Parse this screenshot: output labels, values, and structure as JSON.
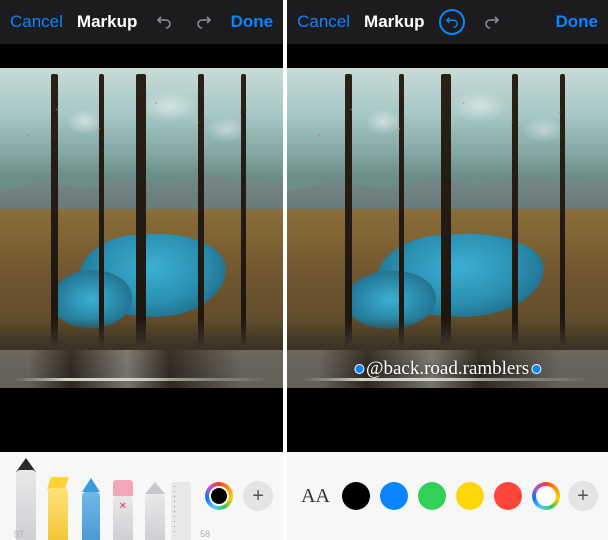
{
  "panes": [
    {
      "header": {
        "cancel": "Cancel",
        "title": "Markup",
        "done": "Done",
        "undo_active": false
      },
      "watermark": null,
      "toolbar": {
        "mode": "tools",
        "tools": [
          "pen",
          "marker",
          "pencil",
          "eraser",
          "lasso",
          "ruler"
        ],
        "plus": "+",
        "hint_left": "97",
        "hint_right": "58"
      }
    },
    {
      "header": {
        "cancel": "Cancel",
        "title": "Markup",
        "done": "Done",
        "undo_active": true
      },
      "watermark": "@back.road.ramblers",
      "toolbar": {
        "mode": "palette",
        "font_button": "AA",
        "swatches": [
          {
            "name": "black",
            "hex": "#000000"
          },
          {
            "name": "blue",
            "hex": "#0a84ff"
          },
          {
            "name": "green",
            "hex": "#30d158"
          },
          {
            "name": "yellow",
            "hex": "#ffd60a"
          },
          {
            "name": "red",
            "hex": "#ff453a"
          }
        ],
        "plus": "+"
      }
    }
  ],
  "colors": {
    "accent": "#0a84ff",
    "header_bg": "#1c1c1e",
    "toolbar_bg": "#f7f7f8"
  }
}
